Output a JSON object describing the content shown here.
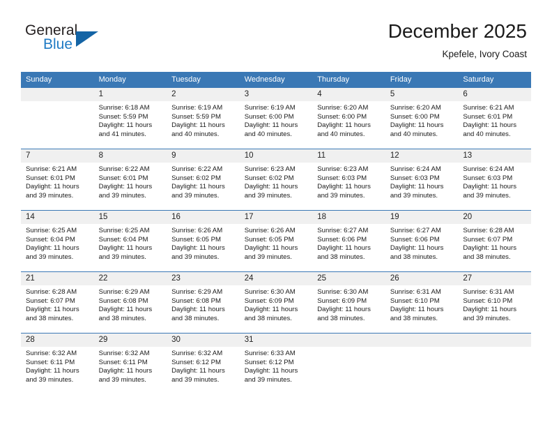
{
  "brand": {
    "name_part1": "General",
    "name_part2": "Blue",
    "accent_color": "#1464a5",
    "text_color": "#231f20"
  },
  "header": {
    "title": "December 2025",
    "subtitle": "Kpefele, Ivory Coast"
  },
  "calendar": {
    "header_bg": "#3a78b5",
    "daynum_bg": "#f0f0f0",
    "weekdays": [
      "Sunday",
      "Monday",
      "Tuesday",
      "Wednesday",
      "Thursday",
      "Friday",
      "Saturday"
    ],
    "weeks": [
      [
        {
          "day": "",
          "blank": true,
          "sunrise": "",
          "sunset": "",
          "daylight1": "",
          "daylight2": ""
        },
        {
          "day": "1",
          "sunrise": "Sunrise: 6:18 AM",
          "sunset": "Sunset: 5:59 PM",
          "daylight1": "Daylight: 11 hours",
          "daylight2": "and 41 minutes."
        },
        {
          "day": "2",
          "sunrise": "Sunrise: 6:19 AM",
          "sunset": "Sunset: 5:59 PM",
          "daylight1": "Daylight: 11 hours",
          "daylight2": "and 40 minutes."
        },
        {
          "day": "3",
          "sunrise": "Sunrise: 6:19 AM",
          "sunset": "Sunset: 6:00 PM",
          "daylight1": "Daylight: 11 hours",
          "daylight2": "and 40 minutes."
        },
        {
          "day": "4",
          "sunrise": "Sunrise: 6:20 AM",
          "sunset": "Sunset: 6:00 PM",
          "daylight1": "Daylight: 11 hours",
          "daylight2": "and 40 minutes."
        },
        {
          "day": "5",
          "sunrise": "Sunrise: 6:20 AM",
          "sunset": "Sunset: 6:00 PM",
          "daylight1": "Daylight: 11 hours",
          "daylight2": "and 40 minutes."
        },
        {
          "day": "6",
          "sunrise": "Sunrise: 6:21 AM",
          "sunset": "Sunset: 6:01 PM",
          "daylight1": "Daylight: 11 hours",
          "daylight2": "and 40 minutes."
        }
      ],
      [
        {
          "day": "7",
          "sunrise": "Sunrise: 6:21 AM",
          "sunset": "Sunset: 6:01 PM",
          "daylight1": "Daylight: 11 hours",
          "daylight2": "and 39 minutes."
        },
        {
          "day": "8",
          "sunrise": "Sunrise: 6:22 AM",
          "sunset": "Sunset: 6:01 PM",
          "daylight1": "Daylight: 11 hours",
          "daylight2": "and 39 minutes."
        },
        {
          "day": "9",
          "sunrise": "Sunrise: 6:22 AM",
          "sunset": "Sunset: 6:02 PM",
          "daylight1": "Daylight: 11 hours",
          "daylight2": "and 39 minutes."
        },
        {
          "day": "10",
          "sunrise": "Sunrise: 6:23 AM",
          "sunset": "Sunset: 6:02 PM",
          "daylight1": "Daylight: 11 hours",
          "daylight2": "and 39 minutes."
        },
        {
          "day": "11",
          "sunrise": "Sunrise: 6:23 AM",
          "sunset": "Sunset: 6:03 PM",
          "daylight1": "Daylight: 11 hours",
          "daylight2": "and 39 minutes."
        },
        {
          "day": "12",
          "sunrise": "Sunrise: 6:24 AM",
          "sunset": "Sunset: 6:03 PM",
          "daylight1": "Daylight: 11 hours",
          "daylight2": "and 39 minutes."
        },
        {
          "day": "13",
          "sunrise": "Sunrise: 6:24 AM",
          "sunset": "Sunset: 6:03 PM",
          "daylight1": "Daylight: 11 hours",
          "daylight2": "and 39 minutes."
        }
      ],
      [
        {
          "day": "14",
          "sunrise": "Sunrise: 6:25 AM",
          "sunset": "Sunset: 6:04 PM",
          "daylight1": "Daylight: 11 hours",
          "daylight2": "and 39 minutes."
        },
        {
          "day": "15",
          "sunrise": "Sunrise: 6:25 AM",
          "sunset": "Sunset: 6:04 PM",
          "daylight1": "Daylight: 11 hours",
          "daylight2": "and 39 minutes."
        },
        {
          "day": "16",
          "sunrise": "Sunrise: 6:26 AM",
          "sunset": "Sunset: 6:05 PM",
          "daylight1": "Daylight: 11 hours",
          "daylight2": "and 39 minutes."
        },
        {
          "day": "17",
          "sunrise": "Sunrise: 6:26 AM",
          "sunset": "Sunset: 6:05 PM",
          "daylight1": "Daylight: 11 hours",
          "daylight2": "and 39 minutes."
        },
        {
          "day": "18",
          "sunrise": "Sunrise: 6:27 AM",
          "sunset": "Sunset: 6:06 PM",
          "daylight1": "Daylight: 11 hours",
          "daylight2": "and 38 minutes."
        },
        {
          "day": "19",
          "sunrise": "Sunrise: 6:27 AM",
          "sunset": "Sunset: 6:06 PM",
          "daylight1": "Daylight: 11 hours",
          "daylight2": "and 38 minutes."
        },
        {
          "day": "20",
          "sunrise": "Sunrise: 6:28 AM",
          "sunset": "Sunset: 6:07 PM",
          "daylight1": "Daylight: 11 hours",
          "daylight2": "and 38 minutes."
        }
      ],
      [
        {
          "day": "21",
          "sunrise": "Sunrise: 6:28 AM",
          "sunset": "Sunset: 6:07 PM",
          "daylight1": "Daylight: 11 hours",
          "daylight2": "and 38 minutes."
        },
        {
          "day": "22",
          "sunrise": "Sunrise: 6:29 AM",
          "sunset": "Sunset: 6:08 PM",
          "daylight1": "Daylight: 11 hours",
          "daylight2": "and 38 minutes."
        },
        {
          "day": "23",
          "sunrise": "Sunrise: 6:29 AM",
          "sunset": "Sunset: 6:08 PM",
          "daylight1": "Daylight: 11 hours",
          "daylight2": "and 38 minutes."
        },
        {
          "day": "24",
          "sunrise": "Sunrise: 6:30 AM",
          "sunset": "Sunset: 6:09 PM",
          "daylight1": "Daylight: 11 hours",
          "daylight2": "and 38 minutes."
        },
        {
          "day": "25",
          "sunrise": "Sunrise: 6:30 AM",
          "sunset": "Sunset: 6:09 PM",
          "daylight1": "Daylight: 11 hours",
          "daylight2": "and 38 minutes."
        },
        {
          "day": "26",
          "sunrise": "Sunrise: 6:31 AM",
          "sunset": "Sunset: 6:10 PM",
          "daylight1": "Daylight: 11 hours",
          "daylight2": "and 38 minutes."
        },
        {
          "day": "27",
          "sunrise": "Sunrise: 6:31 AM",
          "sunset": "Sunset: 6:10 PM",
          "daylight1": "Daylight: 11 hours",
          "daylight2": "and 39 minutes."
        }
      ],
      [
        {
          "day": "28",
          "sunrise": "Sunrise: 6:32 AM",
          "sunset": "Sunset: 6:11 PM",
          "daylight1": "Daylight: 11 hours",
          "daylight2": "and 39 minutes."
        },
        {
          "day": "29",
          "sunrise": "Sunrise: 6:32 AM",
          "sunset": "Sunset: 6:11 PM",
          "daylight1": "Daylight: 11 hours",
          "daylight2": "and 39 minutes."
        },
        {
          "day": "30",
          "sunrise": "Sunrise: 6:32 AM",
          "sunset": "Sunset: 6:12 PM",
          "daylight1": "Daylight: 11 hours",
          "daylight2": "and 39 minutes."
        },
        {
          "day": "31",
          "sunrise": "Sunrise: 6:33 AM",
          "sunset": "Sunset: 6:12 PM",
          "daylight1": "Daylight: 11 hours",
          "daylight2": "and 39 minutes."
        },
        {
          "day": "",
          "blank": true,
          "sunrise": "",
          "sunset": "",
          "daylight1": "",
          "daylight2": ""
        },
        {
          "day": "",
          "blank": true,
          "sunrise": "",
          "sunset": "",
          "daylight1": "",
          "daylight2": ""
        },
        {
          "day": "",
          "blank": true,
          "sunrise": "",
          "sunset": "",
          "daylight1": "",
          "daylight2": ""
        }
      ]
    ]
  }
}
